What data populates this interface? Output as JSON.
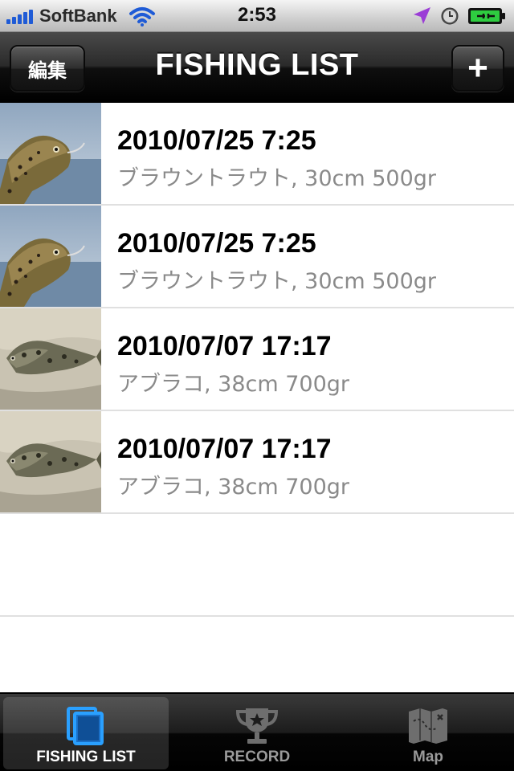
{
  "status_bar": {
    "carrier": "SoftBank",
    "time": "2:53",
    "signal_bars": 5,
    "icons": [
      "signal-icon",
      "wifi-icon",
      "location-arrow-icon",
      "clock-icon",
      "battery-charging-icon"
    ]
  },
  "nav": {
    "title": "FISHING LIST",
    "edit_label": "編集",
    "add_label": "+"
  },
  "rows": [
    {
      "title": "2010/07/25 7:25",
      "subtitle": "ブラウントラウト, 30cm 500gr",
      "photo": "trout-photo"
    },
    {
      "title": "2010/07/25 7:25",
      "subtitle": "ブラウントラウト, 30cm 500gr",
      "photo": "trout-photo"
    },
    {
      "title": "2010/07/07 17:17",
      "subtitle": "アブラコ, 38cm 700gr",
      "photo": "greenling-photo"
    },
    {
      "title": "2010/07/07 17:17",
      "subtitle": "アブラコ, 38cm 700gr",
      "photo": "greenling-photo"
    }
  ],
  "tabs": [
    {
      "label": "FISHING LIST",
      "icon": "list-icon",
      "active": true
    },
    {
      "label": "RECORD",
      "icon": "trophy-icon",
      "active": false
    },
    {
      "label": "Map",
      "icon": "map-icon",
      "active": false
    }
  ],
  "colors": {
    "signal": "#1f5bd6",
    "active_tab_icon": "#2aa0ff",
    "subtitle": "#8a8a8a",
    "location_arrow": "#9b3dd6",
    "battery": "#2ecc40"
  }
}
